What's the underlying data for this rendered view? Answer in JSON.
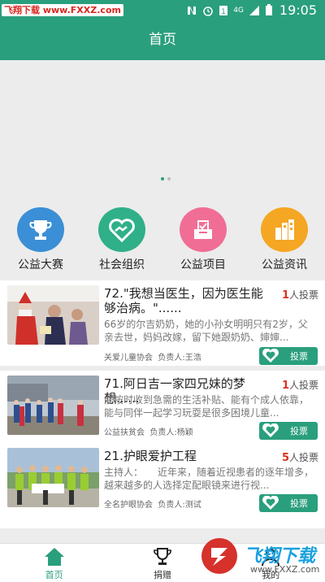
{
  "statusbar": {
    "watermark": "飞翔下载 www.FXXZ.com",
    "network": "4G",
    "time": "19:05"
  },
  "header": {
    "title": "首页"
  },
  "banner": {
    "dots": 2,
    "active_dot": 0
  },
  "categories": [
    {
      "label": "公益大赛",
      "icon": "trophy-icon",
      "color": "#3b8fd6"
    },
    {
      "label": "社会组织",
      "icon": "handshake-heart-icon",
      "color": "#2fb088"
    },
    {
      "label": "公益项目",
      "icon": "ballot-box-icon",
      "color": "#f06e95"
    },
    {
      "label": "公益资讯",
      "icon": "buildings-icon",
      "color": "#f5a623"
    }
  ],
  "projects": [
    {
      "title": "72.\"我想当医生，因为医生能够治病。\"......",
      "votes_count": "1",
      "votes_suffix": "人投票",
      "desc": "66岁的尔吉奶奶，她的小孙女明明只有2岁，父亲去世，妈妈改嫁，留下她跟奶奶、婶婶...",
      "org": "关爱儿童协会",
      "owner": "负责人:王浩",
      "vote_label": "投票"
    },
    {
      "title": "71.阿日吉一家四兄妹的梦想......",
      "votes_count": "1",
      "votes_suffix": "人投票",
      "desc": "能按时收到急需的生活补贴、能有个成人依靠，能与同伴一起学习玩耍是很多困境儿童...",
      "org": "公益扶贫会",
      "owner": "负责人:杨颖",
      "vote_label": "投票"
    },
    {
      "title": "21.护眼爱护工程",
      "votes_count": "5",
      "votes_suffix": "人投票",
      "desc": "主持人：　　近年来，随着近视患者的逐年增多，越来越多的人选择定配眼镜来进行视...",
      "org": "全名护眼协会",
      "owner": "负责人:测试",
      "vote_label": "投票"
    }
  ],
  "bottomnav": [
    {
      "label": "首页",
      "icon": "home-icon"
    },
    {
      "label": "捐赠",
      "icon": "trophy-outline-icon"
    },
    {
      "label": "我的",
      "icon": "user-icon"
    }
  ],
  "brand_watermark": {
    "text": "飞翔下载",
    "url": "www.FXXZ.com"
  },
  "colors": {
    "accent": "#2a9f7d",
    "vote_count": "#d8341f"
  }
}
